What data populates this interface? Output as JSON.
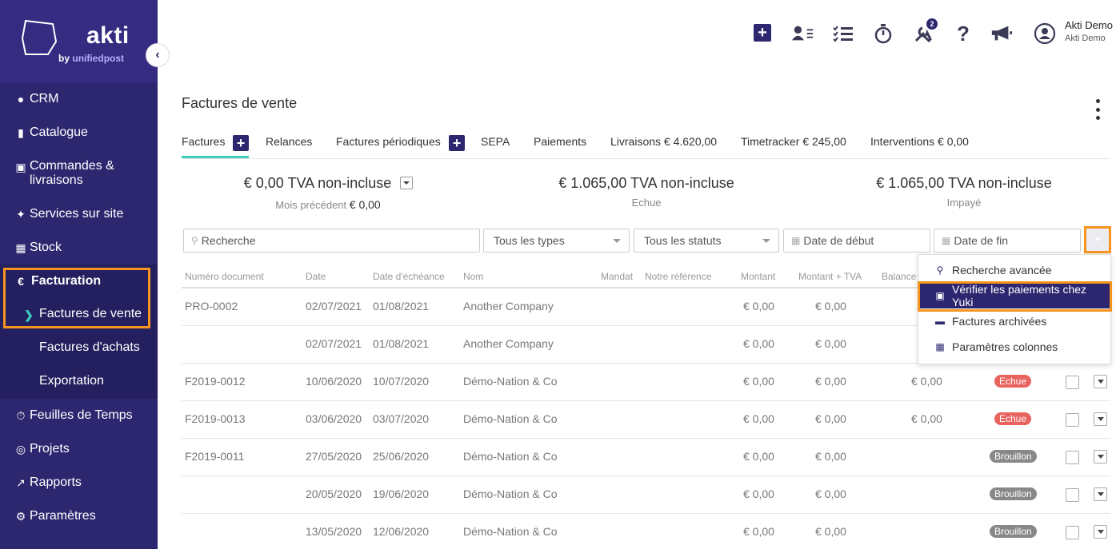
{
  "brand": {
    "name": "akti",
    "by": "by",
    "company": "unifiedpost"
  },
  "sidebar": {
    "items": [
      {
        "label": "CRM",
        "icon": "user-icon"
      },
      {
        "label": "Catalogue",
        "icon": "book-icon"
      },
      {
        "label": "Commandes & livraisons",
        "icon": "cart-icon"
      },
      {
        "label": "Services sur site",
        "icon": "wrench-icon"
      },
      {
        "label": "Stock",
        "icon": "boxes-icon"
      },
      {
        "label": "Facturation",
        "icon": "euro-icon"
      },
      {
        "label": "Feuilles de Temps",
        "icon": "stopwatch-icon"
      },
      {
        "label": "Projets",
        "icon": "target-icon"
      },
      {
        "label": "Rapports",
        "icon": "chart-icon"
      },
      {
        "label": "Paramètres",
        "icon": "gear-icon"
      }
    ],
    "facturation_sub": [
      {
        "label": "Factures de vente"
      },
      {
        "label": "Factures d'achats"
      },
      {
        "label": "Exportation"
      }
    ]
  },
  "topbar": {
    "tools_badge": "2",
    "user_name": "Akti Demo",
    "user_company": "Akti Demo"
  },
  "page": {
    "title": "Factures de vente"
  },
  "tabs": [
    {
      "label": "Factures"
    },
    {
      "label": "Relances"
    },
    {
      "label": "Factures périodiques"
    },
    {
      "label": "SEPA"
    },
    {
      "label": "Paiements"
    },
    {
      "label": "Livraisons € 4.620,00"
    },
    {
      "label": "Timetracker € 245,00"
    },
    {
      "label": "Interventions € 0,00"
    }
  ],
  "summary": {
    "previous": {
      "value": "€ 0,00 TVA non-incluse",
      "label": "Mois précédent",
      "amount": "€ 0,00"
    },
    "due": {
      "value": "€ 1.065,00 TVA non-incluse",
      "label": "Echue"
    },
    "unpaid": {
      "value": "€ 1.065,00 TVA non-incluse",
      "label": "Impayé"
    }
  },
  "filters": {
    "search_placeholder": "Recherche",
    "type_value": "Tous les types",
    "status_value": "Tous les statuts",
    "start_placeholder": "Date de début",
    "end_placeholder": "Date de fin"
  },
  "table": {
    "headers": [
      "Numéro document",
      "Date",
      "Date d'échéance",
      "Nom",
      "Mandat",
      "Notre référence",
      "Montant",
      "Montant + TVA",
      "Balance"
    ],
    "rows": [
      {
        "doc": "PRO-0002",
        "date": "02/07/2021",
        "due": "01/08/2021",
        "name": "Another Company",
        "amount": "€ 0,00",
        "amount_vat": "€ 0,00",
        "balance": "",
        "status": ""
      },
      {
        "doc": "",
        "date": "02/07/2021",
        "due": "01/08/2021",
        "name": "Another Company",
        "amount": "€ 0,00",
        "amount_vat": "€ 0,00",
        "balance": "",
        "status": ""
      },
      {
        "doc": "F2019-0012",
        "date": "10/06/2020",
        "due": "10/07/2020",
        "name": "Démo-Nation & Co",
        "amount": "€ 0,00",
        "amount_vat": "€ 0,00",
        "balance": "€ 0,00",
        "status": "Echue"
      },
      {
        "doc": "F2019-0013",
        "date": "03/06/2020",
        "due": "03/07/2020",
        "name": "Démo-Nation & Co",
        "amount": "€ 0,00",
        "amount_vat": "€ 0,00",
        "balance": "€ 0,00",
        "status": "Echue"
      },
      {
        "doc": "F2019-0011",
        "date": "27/05/2020",
        "due": "25/06/2020",
        "name": "Démo-Nation & Co",
        "amount": "€ 0,00",
        "amount_vat": "€ 0,00",
        "balance": "",
        "status": "Brouillon"
      },
      {
        "doc": "",
        "date": "20/05/2020",
        "due": "19/06/2020",
        "name": "Démo-Nation & Co",
        "amount": "€ 0,00",
        "amount_vat": "€ 0,00",
        "balance": "",
        "status": "Brouillon"
      },
      {
        "doc": "",
        "date": "13/05/2020",
        "due": "12/06/2020",
        "name": "Démo-Nation & Co",
        "amount": "€ 0,00",
        "amount_vat": "€ 0,00",
        "balance": "",
        "status": "Brouillon"
      }
    ]
  },
  "menu": {
    "items": [
      {
        "label": "Recherche avancée",
        "icon": "search-icon"
      },
      {
        "label": "Vérifier les paiements chez Yuki",
        "icon": "money-icon"
      },
      {
        "label": "Factures archivées",
        "icon": "archive-icon"
      },
      {
        "label": "Paramètres colonnes",
        "icon": "grid-icon"
      }
    ]
  },
  "colors": {
    "sidebar": "#2d2770",
    "accent": "#3ecfc0",
    "highlight": "#f7941d",
    "echue": "#e8625e",
    "brouillon": "#888888"
  }
}
